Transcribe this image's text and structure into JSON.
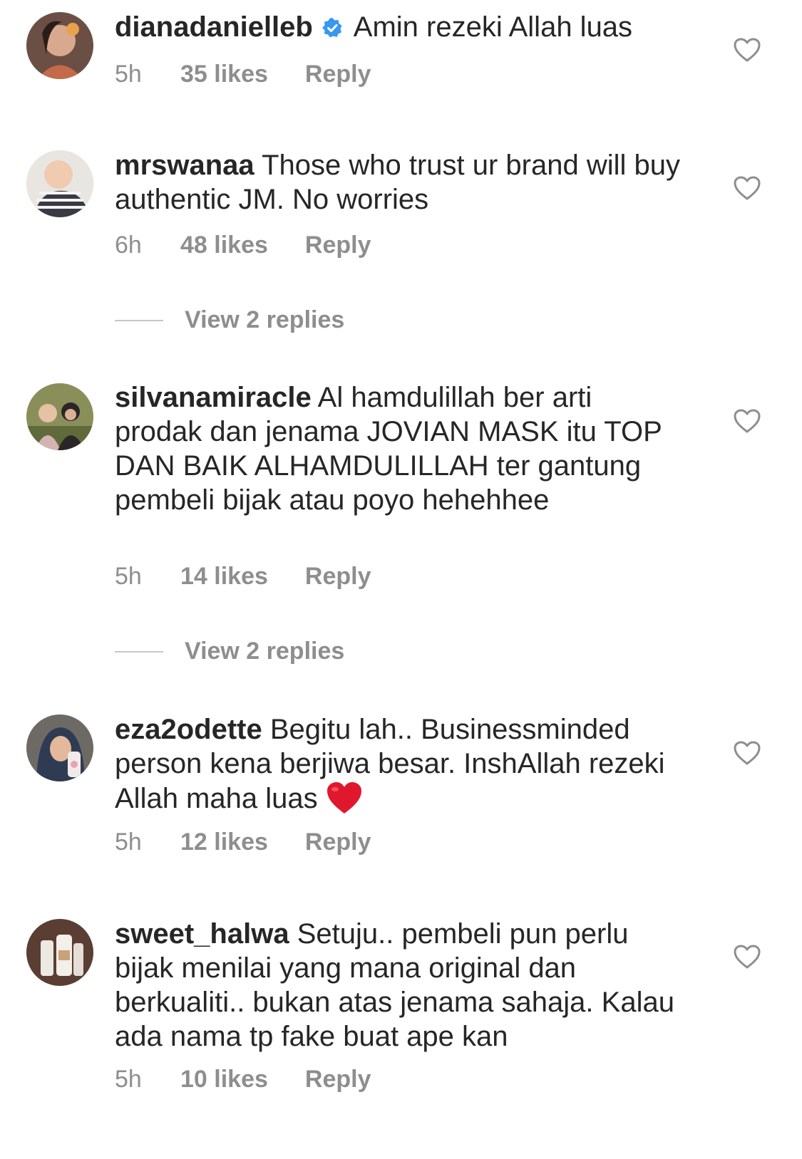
{
  "comments": [
    {
      "username": "dianadanielleb",
      "verified": true,
      "text": "Amin rezeki Allah luas",
      "time": "5h",
      "likes": "35 likes",
      "reply": "Reply"
    },
    {
      "username": "mrswanaa",
      "text": "Those who trust ur brand will buy authentic JM. No worries",
      "time": "6h",
      "likes": "48 likes",
      "reply": "Reply",
      "view_replies": "View 2 replies"
    },
    {
      "username": "silvanamiracle",
      "text": "Al hamdulillah ber arti prodak dan jenama JOVIAN MASK itu TOP DAN BAIK ALHAMDULILLAH ter gantung pembeli bijak atau poyo hehehhee",
      "time": "5h",
      "likes": "14 likes",
      "reply": "Reply",
      "view_replies": "View 2 replies"
    },
    {
      "username": "eza2odette",
      "text": "Begitu lah.. Businessminded person kena berjiwa besar. InshAllah rezeki Allah maha luas",
      "emoji": "red-heart-emoji",
      "time": "5h",
      "likes": "12 likes",
      "reply": "Reply"
    },
    {
      "username": "sweet_halwa",
      "text": "Setuju.. pembeli pun perlu bijak menilai yang mana original dan berkualiti.. bukan atas jenama sahaja. Kalau ada nama tp fake buat ape kan",
      "time": "5h",
      "likes": "10 likes",
      "reply": "Reply"
    }
  ],
  "icons": {
    "like": "heart-outline-icon",
    "verified": "verified-badge-icon"
  },
  "colors": {
    "text": "#262626",
    "secondary": "#8e8e8e",
    "verified": "#3897f0",
    "emoji_heart": "#e0182d"
  }
}
